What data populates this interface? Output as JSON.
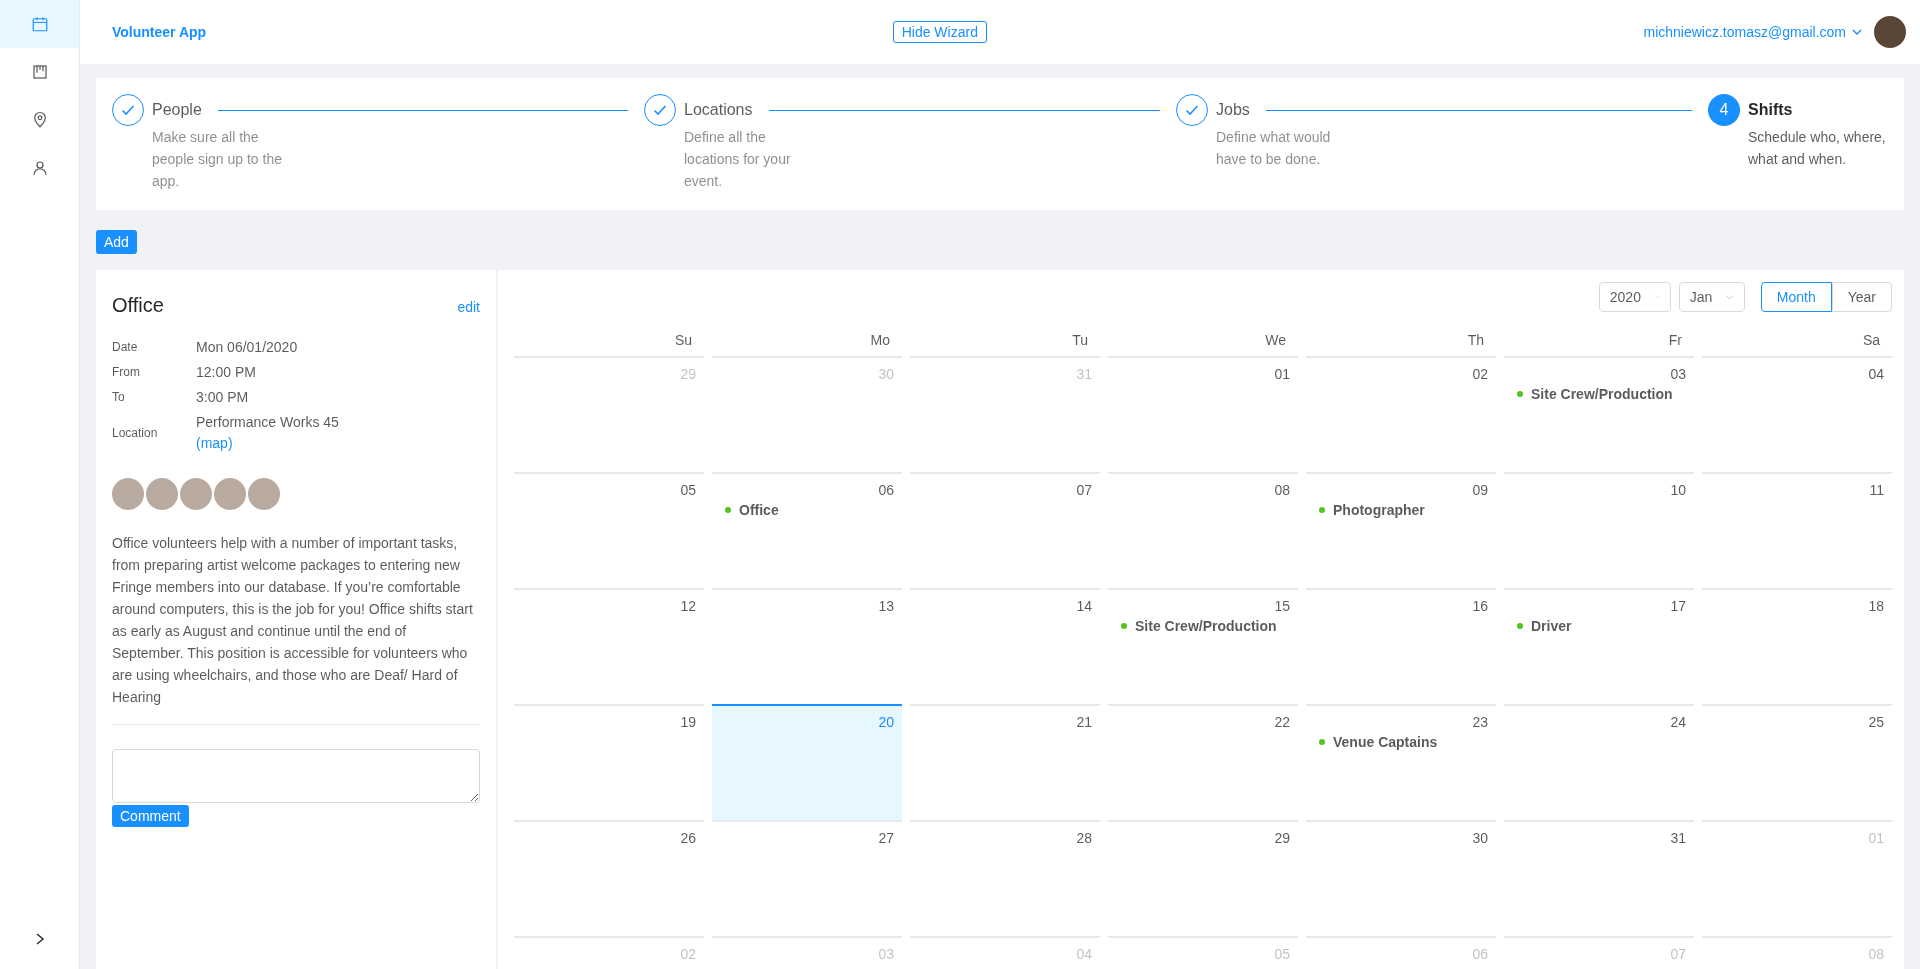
{
  "sidebar": {
    "items": [
      {
        "kind": "calendar",
        "selected": true
      },
      {
        "kind": "board",
        "selected": false
      },
      {
        "kind": "pin",
        "selected": false
      },
      {
        "kind": "user",
        "selected": false
      }
    ]
  },
  "header": {
    "app_name": "Volunteer App",
    "wizard_button": "Hide Wizard",
    "user_email": "michniewicz.tomasz@gmail.com"
  },
  "wizard": {
    "steps": [
      {
        "title": "People",
        "description": "Make sure all the people sign up to the app.",
        "completed": true
      },
      {
        "title": "Locations",
        "description": "Define all the locations for your event.",
        "completed": true
      },
      {
        "title": "Jobs",
        "description": "Define what would have to be done.",
        "completed": true
      },
      {
        "number": "4",
        "title": "Shifts",
        "description": "Schedule who, where, what and when.",
        "completed": false
      }
    ]
  },
  "add_button": "Add",
  "shift": {
    "title": "Office",
    "edit_link": "edit",
    "details": [
      {
        "label": "Date",
        "value": "Mon 06/01/2020"
      },
      {
        "label": "From",
        "value": "12:00 PM"
      },
      {
        "label": "To",
        "value": "3:00 PM"
      },
      {
        "label": "Location",
        "value": "Performance Works 45",
        "link": "(map)"
      }
    ],
    "volunteers": [
      {
        "kind": "photo"
      },
      {
        "kind": "photo"
      },
      {
        "kind": "photo"
      },
      {
        "kind": "photo"
      },
      {
        "kind": "photo"
      }
    ],
    "description": "Office volunteers help with a number of important tasks, from preparing artist welcome packages to entering new Fringe members into our database. If you’re comfortable around computers, this is the job for you! Office shifts start as early as August and continue until the end of September. This position is accessible for volunteers who are using wheelchairs, and those who are Deaf/ Hard of Hearing",
    "comment_button": "Comment"
  },
  "calendar": {
    "year": "2020",
    "month": "Jan",
    "views": [
      {
        "label": "Month",
        "selected": true
      },
      {
        "label": "Year",
        "selected": false
      }
    ],
    "weekdays": [
      "Su",
      "Mo",
      "Tu",
      "We",
      "Th",
      "Fr",
      "Sa"
    ],
    "weeks": [
      [
        {
          "date": "29",
          "in_month": false,
          "selected": false
        },
        {
          "date": "30",
          "in_month": false,
          "selected": false
        },
        {
          "date": "31",
          "in_month": false,
          "selected": false
        },
        {
          "date": "01",
          "in_month": true,
          "selected": false
        },
        {
          "date": "02",
          "in_month": true,
          "selected": false
        },
        {
          "date": "03",
          "in_month": true,
          "selected": false,
          "events": [
            {
              "label": "Site Crew/Production",
              "color": "#52c41a"
            }
          ]
        },
        {
          "date": "04",
          "in_month": true,
          "selected": false
        }
      ],
      [
        {
          "date": "05",
          "in_month": true,
          "selected": false
        },
        {
          "date": "06",
          "in_month": true,
          "selected": false,
          "events": [
            {
              "label": "Office",
              "color": "#52c41a"
            }
          ]
        },
        {
          "date": "07",
          "in_month": true,
          "selected": false
        },
        {
          "date": "08",
          "in_month": true,
          "selected": false
        },
        {
          "date": "09",
          "in_month": true,
          "selected": false,
          "events": [
            {
              "label": "Photographer",
              "color": "#52c41a"
            }
          ]
        },
        {
          "date": "10",
          "in_month": true,
          "selected": false
        },
        {
          "date": "11",
          "in_month": true,
          "selected": false
        }
      ],
      [
        {
          "date": "12",
          "in_month": true,
          "selected": false
        },
        {
          "date": "13",
          "in_month": true,
          "selected": false
        },
        {
          "date": "14",
          "in_month": true,
          "selected": false
        },
        {
          "date": "15",
          "in_month": true,
          "selected": false,
          "events": [
            {
              "label": "Site Crew/Production",
              "color": "#52c41a"
            }
          ]
        },
        {
          "date": "16",
          "in_month": true,
          "selected": false
        },
        {
          "date": "17",
          "in_month": true,
          "selected": false,
          "events": [
            {
              "label": "Driver",
              "color": "#52c41a"
            }
          ]
        },
        {
          "date": "18",
          "in_month": true,
          "selected": false
        }
      ],
      [
        {
          "date": "19",
          "in_month": true,
          "selected": false
        },
        {
          "date": "20",
          "in_month": true,
          "selected": true
        },
        {
          "date": "21",
          "in_month": true,
          "selected": false
        },
        {
          "date": "22",
          "in_month": true,
          "selected": false
        },
        {
          "date": "23",
          "in_month": true,
          "selected": false,
          "events": [
            {
              "label": "Venue Captains",
              "color": "#52c41a"
            }
          ]
        },
        {
          "date": "24",
          "in_month": true,
          "selected": false
        },
        {
          "date": "25",
          "in_month": true,
          "selected": false
        }
      ],
      [
        {
          "date": "26",
          "in_month": true,
          "selected": false
        },
        {
          "date": "27",
          "in_month": true,
          "selected": false
        },
        {
          "date": "28",
          "in_month": true,
          "selected": false
        },
        {
          "date": "29",
          "in_month": true,
          "selected": false
        },
        {
          "date": "30",
          "in_month": true,
          "selected": false
        },
        {
          "date": "31",
          "in_month": true,
          "selected": false
        },
        {
          "date": "01",
          "in_month": false,
          "selected": false
        }
      ],
      [
        {
          "date": "02",
          "in_month": false,
          "selected": false
        },
        {
          "date": "03",
          "in_month": false,
          "selected": false
        },
        {
          "date": "04",
          "in_month": false,
          "selected": false
        },
        {
          "date": "05",
          "in_month": false,
          "selected": false
        },
        {
          "date": "06",
          "in_month": false,
          "selected": false
        },
        {
          "date": "07",
          "in_month": false,
          "selected": false
        },
        {
          "date": "08",
          "in_month": false,
          "selected": false
        }
      ]
    ]
  }
}
